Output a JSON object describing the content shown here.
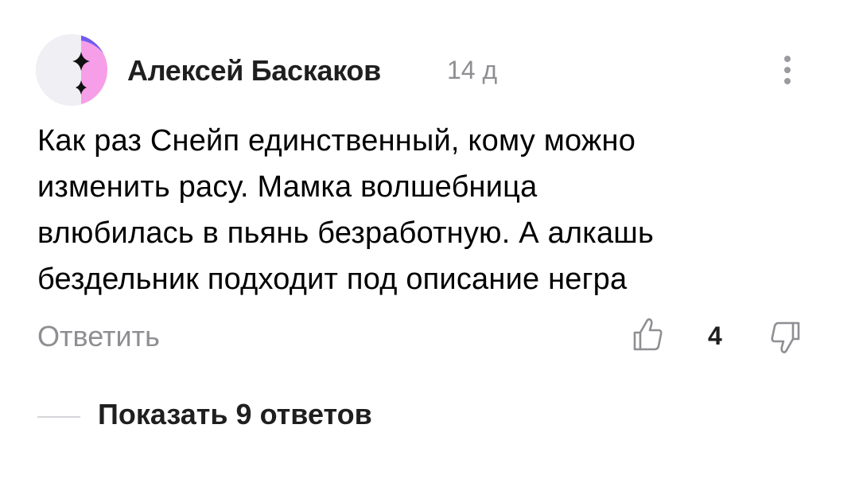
{
  "comment": {
    "author": "Алексей Баскаков",
    "time": "14 д",
    "body_lines": [
      "Как раз Снейп единственный, кому можно",
      "изменить расу. Мамка волшебница",
      "влюбилась в пьянь безработную. А алкашь",
      "бездельник подходит под описание негра"
    ],
    "reply_label": "Ответить",
    "like_count": "4",
    "show_replies_label": "Показать 9 ответов",
    "icons": {
      "avatar": "avatar-sparkle-icon",
      "more": "more-vertical-icon",
      "like": "thumb-up-icon",
      "dislike": "thumb-down-icon"
    },
    "colors": {
      "avatar_purple": "#6f5cf2",
      "avatar_pink": "#f79ee8",
      "avatar_bg": "#efeff4",
      "secondary_text": "#8e8e93"
    }
  }
}
